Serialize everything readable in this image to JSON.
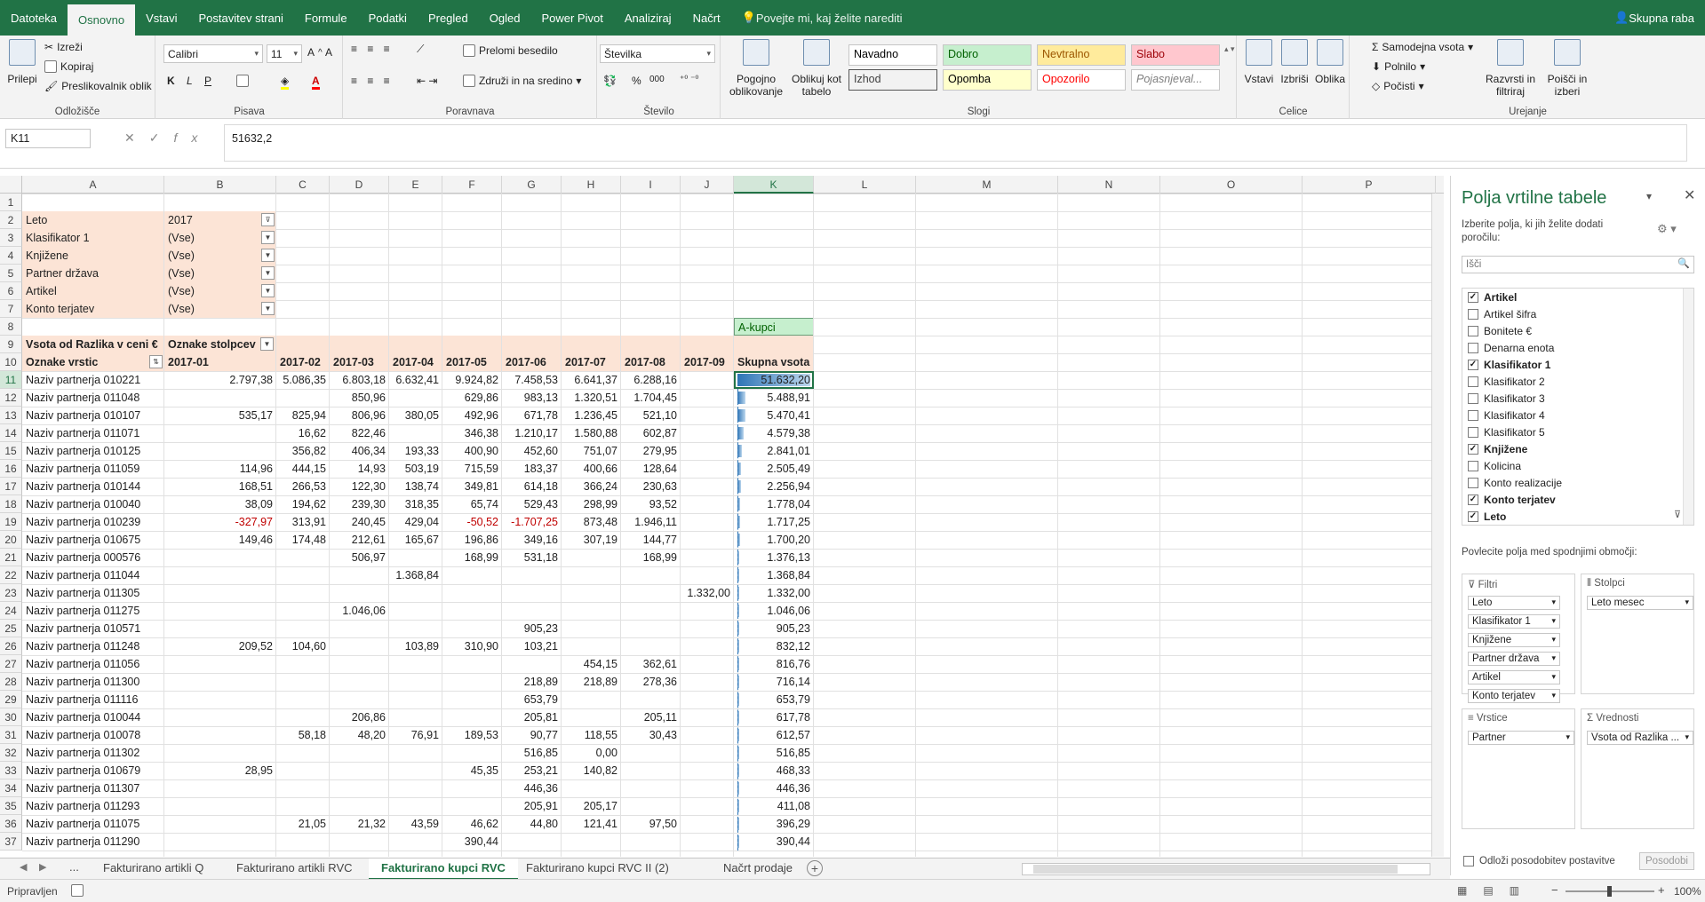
{
  "tabs": [
    "Datoteka",
    "Osnovno",
    "Vstavi",
    "Postavitev strani",
    "Formule",
    "Podatki",
    "Pregled",
    "Ogled",
    "Power Pivot",
    "Analiziraj",
    "Načrt"
  ],
  "active_tab": "Osnovno",
  "tell_me": "Povejte mi, kaj želite narediti",
  "share": "Skupna raba",
  "ribbon": {
    "clipboard": {
      "label": "Odložišče",
      "paste": "Prilepi",
      "cut": "Izreži",
      "copy": "Kopiraj",
      "format_painter": "Preslikovalnik oblik"
    },
    "font": {
      "label": "Pisava",
      "name": "Calibri",
      "size": "11"
    },
    "alignment": {
      "label": "Poravnava",
      "wrap": "Prelomi besedilo",
      "merge": "Združi in na sredino"
    },
    "number": {
      "label": "Število",
      "format": "Številka"
    },
    "styles": {
      "label": "Slogi",
      "conditional": "Pogojno oblikovanje",
      "as_table": "Oblikuj kot tabelo",
      "cells": [
        {
          "text": "Navadno",
          "bg": "#ffffff",
          "fg": "#000000"
        },
        {
          "text": "Dobro",
          "bg": "#c6efce",
          "fg": "#006100"
        },
        {
          "text": "Nevtralno",
          "bg": "#ffeb9c",
          "fg": "#9c5700"
        },
        {
          "text": "Slabo",
          "bg": "#ffc7ce",
          "fg": "#9c0006"
        },
        {
          "text": "Izhod",
          "bg": "#f2f2f2",
          "fg": "#3f3f3f"
        },
        {
          "text": "Opomba",
          "bg": "#ffffcc",
          "fg": "#000000"
        },
        {
          "text": "Opozorilo",
          "bg": "#ffffff",
          "fg": "#ff0000"
        },
        {
          "text": "Pojasnjeval...",
          "bg": "#ffffff",
          "fg": "#7f7f7f"
        }
      ]
    },
    "cells": {
      "label": "Celice",
      "insert": "Vstavi",
      "delete": "Izbriši",
      "format": "Oblika"
    },
    "editing": {
      "label": "Urejanje",
      "autosum": "Samodejna vsota",
      "fill": "Polnilo",
      "clear": "Počisti",
      "sort": "Razvrsti in filtriraj",
      "find": "Poišči in izberi"
    }
  },
  "name_box": "K11",
  "formula": "51632,2",
  "columns": [
    "A",
    "B",
    "C",
    "D",
    "E",
    "F",
    "G",
    "H",
    "I",
    "J",
    "K",
    "L",
    "M",
    "N",
    "O",
    "P"
  ],
  "selected_column": "K",
  "selected_row": 11,
  "filters": [
    {
      "label": "Leto",
      "value": "2017"
    },
    {
      "label": "Klasifikator 1",
      "value": "(Vse)"
    },
    {
      "label": "Knjižene",
      "value": "(Vse)"
    },
    {
      "label": "Partner država",
      "value": "(Vse)"
    },
    {
      "label": "Artikel",
      "value": "(Vse)"
    },
    {
      "label": "Konto terjatev",
      "value": "(Vse)"
    }
  ],
  "k8_label": "A-kupci",
  "pivot": {
    "value_label": "Vsota od Razlika v ceni €",
    "col_label": "Oznake stolpcev",
    "row_label": "Oznake vrstic",
    "months": [
      "2017-01",
      "2017-02",
      "2017-03",
      "2017-04",
      "2017-05",
      "2017-06",
      "2017-07",
      "2017-08",
      "2017-09"
    ],
    "total_label": "Skupna vsota",
    "rows": [
      {
        "name": "Naziv partnerja 010221",
        "v": [
          "2.797,38",
          "5.086,35",
          "6.803,18",
          "6.632,41",
          "9.924,82",
          "7.458,53",
          "6.641,37",
          "6.288,16",
          ""
        ],
        "total": "51.632,20"
      },
      {
        "name": "Naziv partnerja 011048",
        "v": [
          "",
          "",
          "850,96",
          "",
          "629,86",
          "983,13",
          "1.320,51",
          "1.704,45",
          ""
        ],
        "total": "5.488,91"
      },
      {
        "name": "Naziv partnerja 010107",
        "v": [
          "535,17",
          "825,94",
          "806,96",
          "380,05",
          "492,96",
          "671,78",
          "1.236,45",
          "521,10",
          ""
        ],
        "total": "5.470,41"
      },
      {
        "name": "Naziv partnerja 011071",
        "v": [
          "",
          "16,62",
          "822,46",
          "",
          "346,38",
          "1.210,17",
          "1.580,88",
          "602,87",
          ""
        ],
        "total": "4.579,38"
      },
      {
        "name": "Naziv partnerja 010125",
        "v": [
          "",
          "356,82",
          "406,34",
          "193,33",
          "400,90",
          "452,60",
          "751,07",
          "279,95",
          ""
        ],
        "total": "2.841,01"
      },
      {
        "name": "Naziv partnerja 011059",
        "v": [
          "114,96",
          "444,15",
          "14,93",
          "503,19",
          "715,59",
          "183,37",
          "400,66",
          "128,64",
          ""
        ],
        "total": "2.505,49"
      },
      {
        "name": "Naziv partnerja 010144",
        "v": [
          "168,51",
          "266,53",
          "122,30",
          "138,74",
          "349,81",
          "614,18",
          "366,24",
          "230,63",
          ""
        ],
        "total": "2.256,94"
      },
      {
        "name": "Naziv partnerja 010040",
        "v": [
          "38,09",
          "194,62",
          "239,30",
          "318,35",
          "65,74",
          "529,43",
          "298,99",
          "93,52",
          ""
        ],
        "total": "1.778,04"
      },
      {
        "name": "Naziv partnerja 010239",
        "v": [
          "-327,97",
          "313,91",
          "240,45",
          "429,04",
          "-50,52",
          "-1.707,25",
          "873,48",
          "1.946,11",
          ""
        ],
        "total": "1.717,25"
      },
      {
        "name": "Naziv partnerja 010675",
        "v": [
          "149,46",
          "174,48",
          "212,61",
          "165,67",
          "196,86",
          "349,16",
          "307,19",
          "144,77",
          ""
        ],
        "total": "1.700,20"
      },
      {
        "name": "Naziv partnerja 000576",
        "v": [
          "",
          "",
          "506,97",
          "",
          "168,99",
          "531,18",
          "",
          "168,99",
          ""
        ],
        "total": "1.376,13"
      },
      {
        "name": "Naziv partnerja 011044",
        "v": [
          "",
          "",
          "",
          "1.368,84",
          "",
          "",
          "",
          "",
          ""
        ],
        "total": "1.368,84"
      },
      {
        "name": "Naziv partnerja 011305",
        "v": [
          "",
          "",
          "",
          "",
          "",
          "",
          "",
          "",
          "1.332,00"
        ],
        "total": "1.332,00"
      },
      {
        "name": "Naziv partnerja 011275",
        "v": [
          "",
          "",
          "1.046,06",
          "",
          "",
          "",
          "",
          "",
          ""
        ],
        "total": "1.046,06"
      },
      {
        "name": "Naziv partnerja 010571",
        "v": [
          "",
          "",
          "",
          "",
          "",
          "905,23",
          "",
          "",
          ""
        ],
        "total": "905,23"
      },
      {
        "name": "Naziv partnerja 011248",
        "v": [
          "209,52",
          "104,60",
          "",
          "103,89",
          "310,90",
          "103,21",
          "",
          "",
          ""
        ],
        "total": "832,12"
      },
      {
        "name": "Naziv partnerja 011056",
        "v": [
          "",
          "",
          "",
          "",
          "",
          "",
          "454,15",
          "362,61",
          ""
        ],
        "total": "816,76"
      },
      {
        "name": "Naziv partnerja 011300",
        "v": [
          "",
          "",
          "",
          "",
          "",
          "218,89",
          "218,89",
          "278,36",
          ""
        ],
        "total": "716,14"
      },
      {
        "name": "Naziv partnerja 011116",
        "v": [
          "",
          "",
          "",
          "",
          "",
          "653,79",
          "",
          "",
          ""
        ],
        "total": "653,79"
      },
      {
        "name": "Naziv partnerja 010044",
        "v": [
          "",
          "",
          "206,86",
          "",
          "",
          "205,81",
          "",
          "205,11",
          ""
        ],
        "total": "617,78"
      },
      {
        "name": "Naziv partnerja 010078",
        "v": [
          "",
          "58,18",
          "48,20",
          "76,91",
          "189,53",
          "90,77",
          "118,55",
          "30,43",
          ""
        ],
        "total": "612,57"
      },
      {
        "name": "Naziv partnerja 011302",
        "v": [
          "",
          "",
          "",
          "",
          "",
          "516,85",
          "0,00",
          "",
          ""
        ],
        "total": "516,85"
      },
      {
        "name": "Naziv partnerja 010679",
        "v": [
          "28,95",
          "",
          "",
          "",
          "45,35",
          "253,21",
          "140,82",
          "",
          ""
        ],
        "total": "468,33"
      },
      {
        "name": "Naziv partnerja 011307",
        "v": [
          "",
          "",
          "",
          "",
          "",
          "446,36",
          "",
          "",
          ""
        ],
        "total": "446,36"
      },
      {
        "name": "Naziv partnerja 011293",
        "v": [
          "",
          "",
          "",
          "",
          "",
          "205,91",
          "205,17",
          "",
          ""
        ],
        "total": "411,08"
      },
      {
        "name": "Naziv partnerja 011075",
        "v": [
          "",
          "21,05",
          "21,32",
          "43,59",
          "46,62",
          "44,80",
          "121,41",
          "97,50",
          ""
        ],
        "total": "396,29"
      },
      {
        "name": "Naziv partnerja 011290",
        "v": [
          "",
          "",
          "",
          "",
          "390,44",
          "",
          "",
          "",
          ""
        ],
        "total": "390,44"
      }
    ]
  },
  "pane": {
    "title": "Polja vrtilne tabele",
    "subtitle": "Izberite polja, ki jih želite dodati poročilu:",
    "search_placeholder": "Išči",
    "fields": [
      {
        "name": "Artikel",
        "checked": true
      },
      {
        "name": "Artikel šifra",
        "checked": false
      },
      {
        "name": "Bonitete €",
        "checked": false
      },
      {
        "name": "Denarna enota",
        "checked": false
      },
      {
        "name": "Klasifikator 1",
        "checked": true
      },
      {
        "name": "Klasifikator 2",
        "checked": false
      },
      {
        "name": "Klasifikator 3",
        "checked": false
      },
      {
        "name": "Klasifikator 4",
        "checked": false
      },
      {
        "name": "Klasifikator 5",
        "checked": false
      },
      {
        "name": "Knjižene",
        "checked": true
      },
      {
        "name": "Kolicina",
        "checked": false
      },
      {
        "name": "Konto realizacije",
        "checked": false
      },
      {
        "name": "Konto terjatev",
        "checked": true
      },
      {
        "name": "Leto",
        "checked": true
      }
    ],
    "drag_text": "Povlecite polja med spodnjimi območji:",
    "filters_label": "Filtri",
    "columns_label": "Stolpci",
    "rows_label": "Vrstice",
    "values_label": "Vrednosti",
    "filter_items": [
      "Leto",
      "Klasifikator 1",
      "Knjižene",
      "Partner država",
      "Artikel",
      "Konto terjatev"
    ],
    "column_items": [
      "Leto mesec"
    ],
    "row_items": [
      "Partner"
    ],
    "value_items": [
      "Vsota od Razlika ..."
    ],
    "defer_label": "Odloži posodobitev postavitve",
    "update_button": "Posodobi"
  },
  "sheets": [
    "Fakturirano artikli Q",
    "Fakturirano artikli RVC",
    "Fakturirano kupci RVC",
    "Fakturirano kupci RVC II (2)",
    "Načrt prodaje"
  ],
  "active_sheet": "Fakturirano kupci RVC",
  "status": "Pripravljen",
  "zoom": "100%"
}
